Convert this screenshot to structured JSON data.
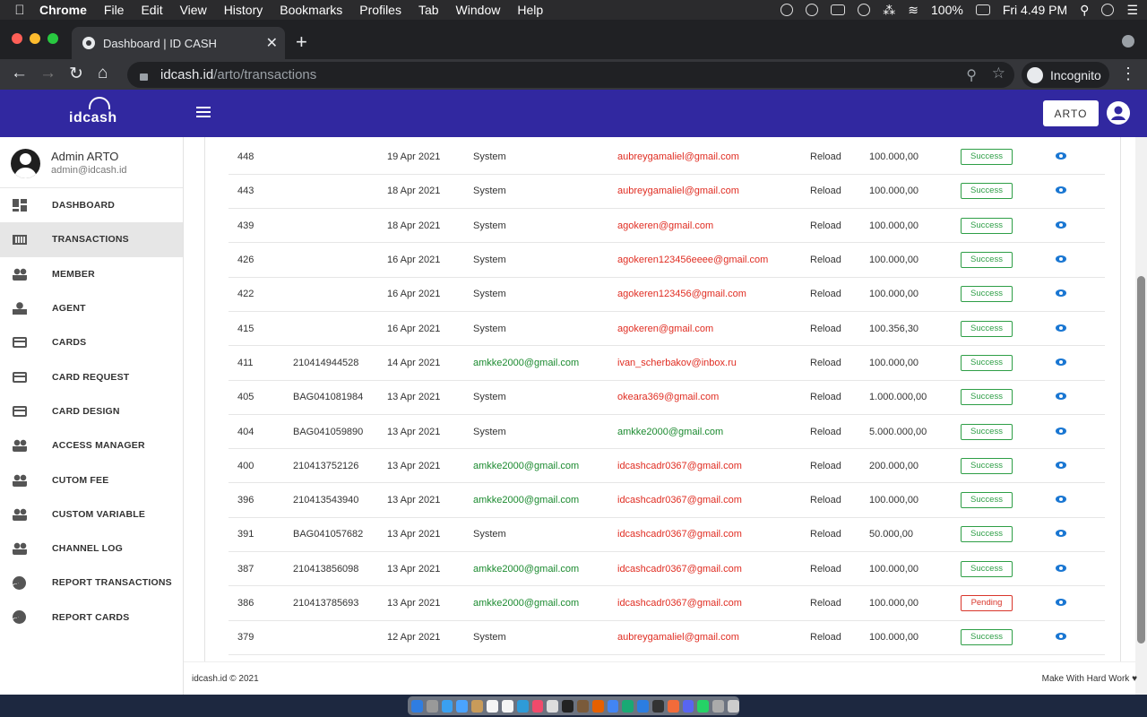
{
  "macos_menu": {
    "app": "Chrome",
    "items": [
      "File",
      "Edit",
      "View",
      "History",
      "Bookmarks",
      "Profiles",
      "Tab",
      "Window",
      "Help"
    ],
    "battery": "100%",
    "clock": "Fri 4.49 PM"
  },
  "browser": {
    "tab_title": "Dashboard | ID CASH",
    "url_host": "idcash.id",
    "url_path": "/arto/transactions",
    "incognito_label": "Incognito"
  },
  "app": {
    "logo_text": "idcash",
    "header_button": "ARTO"
  },
  "sidebar": {
    "user_name": "Admin ARTO",
    "user_email": "admin@idcash.id",
    "items": [
      {
        "label": "DASHBOARD",
        "icon": "dashboard-icon"
      },
      {
        "label": "TRANSACTIONS",
        "icon": "barcode-icon"
      },
      {
        "label": "MEMBER",
        "icon": "people-icon"
      },
      {
        "label": "AGENT",
        "icon": "person-icon"
      },
      {
        "label": "CARDS",
        "icon": "credit-card-icon"
      },
      {
        "label": "CARD REQUEST",
        "icon": "credit-card-icon"
      },
      {
        "label": "CARD DESIGN",
        "icon": "credit-card-icon"
      },
      {
        "label": "ACCESS MANAGER",
        "icon": "people-icon"
      },
      {
        "label": "CUTOM FEE",
        "icon": "people-icon"
      },
      {
        "label": "CUSTOM VARIABLE",
        "icon": "people-icon"
      },
      {
        "label": "CHANNEL LOG",
        "icon": "people-icon"
      },
      {
        "label": "REPORT TRANSACTIONS",
        "icon": "pie-chart-icon"
      },
      {
        "label": "REPORT CARDS",
        "icon": "pie-chart-icon"
      }
    ],
    "active_index": 1
  },
  "transactions": {
    "rows": [
      {
        "id": "448",
        "ref": "",
        "date": "19 Apr 2021",
        "from": "System",
        "to": "aubreygamaliel@gmail.com",
        "to_color": "red",
        "type": "Reload",
        "amount": "100.000,00",
        "status": "Success"
      },
      {
        "id": "443",
        "ref": "",
        "date": "18 Apr 2021",
        "from": "System",
        "to": "aubreygamaliel@gmail.com",
        "to_color": "red",
        "type": "Reload",
        "amount": "100.000,00",
        "status": "Success"
      },
      {
        "id": "439",
        "ref": "",
        "date": "18 Apr 2021",
        "from": "System",
        "to": "agokeren@gmail.com",
        "to_color": "red",
        "type": "Reload",
        "amount": "100.000,00",
        "status": "Success"
      },
      {
        "id": "426",
        "ref": "",
        "date": "16 Apr 2021",
        "from": "System",
        "to": "agokeren123456eeee@gmail.com",
        "to_color": "red",
        "type": "Reload",
        "amount": "100.000,00",
        "status": "Success"
      },
      {
        "id": "422",
        "ref": "",
        "date": "16 Apr 2021",
        "from": "System",
        "to": "agokeren123456@gmail.com",
        "to_color": "red",
        "type": "Reload",
        "amount": "100.000,00",
        "status": "Success"
      },
      {
        "id": "415",
        "ref": "",
        "date": "16 Apr 2021",
        "from": "System",
        "to": "agokeren@gmail.com",
        "to_color": "red",
        "type": "Reload",
        "amount": "100.356,30",
        "status": "Success"
      },
      {
        "id": "411",
        "ref": "210414944528",
        "date": "14 Apr 2021",
        "from": "amkke2000@gmail.com",
        "to": "ivan_scherbakov@inbox.ru",
        "to_color": "red",
        "type": "Reload",
        "amount": "100.000,00",
        "status": "Success"
      },
      {
        "id": "405",
        "ref": "BAG041081984",
        "date": "13 Apr 2021",
        "from": "System",
        "to": "okeara369@gmail.com",
        "to_color": "red",
        "type": "Reload",
        "amount": "1.000.000,00",
        "status": "Success"
      },
      {
        "id": "404",
        "ref": "BAG041059890",
        "date": "13 Apr 2021",
        "from": "System",
        "to": "amkke2000@gmail.com",
        "to_color": "green",
        "type": "Reload",
        "amount": "5.000.000,00",
        "status": "Success"
      },
      {
        "id": "400",
        "ref": "210413752126",
        "date": "13 Apr 2021",
        "from": "amkke2000@gmail.com",
        "to": "idcashcadr0367@gmail.com",
        "to_color": "red",
        "type": "Reload",
        "amount": "200.000,00",
        "status": "Success"
      },
      {
        "id": "396",
        "ref": "210413543940",
        "date": "13 Apr 2021",
        "from": "amkke2000@gmail.com",
        "to": "idcashcadr0367@gmail.com",
        "to_color": "red",
        "type": "Reload",
        "amount": "100.000,00",
        "status": "Success"
      },
      {
        "id": "391",
        "ref": "BAG041057682",
        "date": "13 Apr 2021",
        "from": "System",
        "to": "idcashcadr0367@gmail.com",
        "to_color": "red",
        "type": "Reload",
        "amount": "50.000,00",
        "status": "Success"
      },
      {
        "id": "387",
        "ref": "210413856098",
        "date": "13 Apr 2021",
        "from": "amkke2000@gmail.com",
        "to": "idcashcadr0367@gmail.com",
        "to_color": "red",
        "type": "Reload",
        "amount": "100.000,00",
        "status": "Success"
      },
      {
        "id": "386",
        "ref": "210413785693",
        "date": "13 Apr 2021",
        "from": "amkke2000@gmail.com",
        "to": "idcashcadr0367@gmail.com",
        "to_color": "red",
        "type": "Reload",
        "amount": "100.000,00",
        "status": "Pending"
      },
      {
        "id": "379",
        "ref": "",
        "date": "12 Apr 2021",
        "from": "System",
        "to": "aubreygamaliel@gmail.com",
        "to_color": "red",
        "type": "Reload",
        "amount": "100.000,00",
        "status": "Success"
      }
    ],
    "view_icon": "eye-icon"
  },
  "footer": {
    "copyright": "idcash.id © 2021",
    "tagline": "Make With Hard Work"
  },
  "colors": {
    "header": "#3128a0",
    "success": "#2e9e46",
    "pending": "#d9362b",
    "email_red": "#e02d22",
    "email_green": "#1b8a2f",
    "view_icon": "#1976d2"
  }
}
